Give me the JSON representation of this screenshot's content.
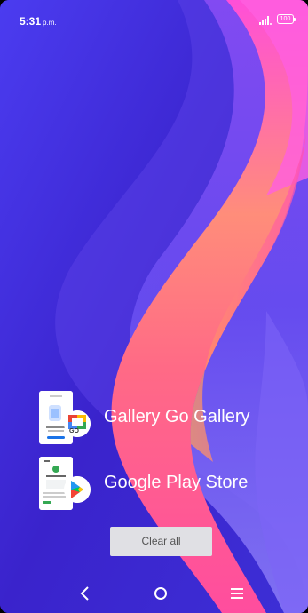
{
  "status": {
    "time": "5:31",
    "ampm": "p.m.",
    "battery": "100",
    "signal_icon": "signal-icon"
  },
  "recents": [
    {
      "label": "Gallery Go Gallery",
      "badge": "GO",
      "icon": "gallery-go-icon"
    },
    {
      "label": "Google Play Store",
      "icon": "play-store-icon"
    }
  ],
  "actions": {
    "clear_all": "Clear all"
  },
  "nav": {
    "back": "back-icon",
    "home": "home-icon",
    "menu": "menu-icon"
  },
  "colors": {
    "background": "#3e2ad6",
    "ribbon_pink": "#ff5bb3",
    "ribbon_orange": "#ff9a6a",
    "clear_button": "#e0e0e4"
  }
}
